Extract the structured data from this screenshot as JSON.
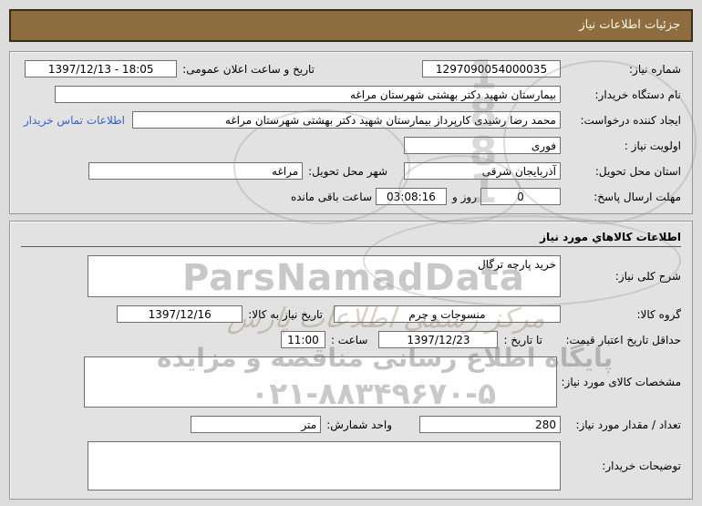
{
  "title_bar": "جزئیات اطلاعات نیاز",
  "section_need": {
    "need_number_label": "شماره نیاز:",
    "need_number_value": "1297090054000035",
    "announce_label": "تاریخ و ساعت اعلان عمومی:",
    "announce_value": "1397/12/13 - 18:05",
    "buyer_org_label": "نام دستگاه خریدار:",
    "buyer_org_value": "بیمارستان شهید دکتر بهشتی شهرستان مراغه",
    "creator_label": "ایجاد کننده درخواست:",
    "creator_value": "محمد رضا رشیدی کارپرداز بیمارستان شهید دکتر بهشتی شهرستان مراغه",
    "contact_link": "اطلاعات تماس خریدار",
    "priority_label": "اولویت نیاز :",
    "priority_value": "فوری",
    "province_label": "استان محل تحویل:",
    "province_value": "آذربایجان شرقی",
    "city_label": "شهر محل تحویل:",
    "city_value": "مراغه",
    "deadline_label": "مهلت ارسال پاسخ:",
    "deadline_days_value": "0",
    "deadline_days_suffix": "روز و",
    "deadline_time_value": "03:08:16",
    "deadline_time_suffix": "ساعت باقی مانده"
  },
  "section_goods": {
    "title": "اطلاعات کالاهاي مورد نیاز",
    "general_desc_label": "شرح کلی نیاز:",
    "general_desc_value": "خرید پارچه ترگال",
    "group_label": "گروه کالا:",
    "group_value": "منسوجات و چرم",
    "need_date_label": "تاریخ نیاز به کالا:",
    "need_date_value": "1397/12/16",
    "price_validity_label": "حداقل تاریخ اعتبار قیمت:",
    "until_date_label": "تا تاریخ :",
    "until_date_value": "1397/12/23",
    "hour_label": "ساعت :",
    "hour_value": "11:00",
    "specs_label": "مشخصات کالای مورد نیاز:",
    "specs_value": "",
    "quantity_label": "تعداد / مقدار مورد نیاز:",
    "quantity_value": "280",
    "unit_label": "واحد شمارش:",
    "unit_value": "متر",
    "buyer_notes_label": "توضیحات خریدار:",
    "buyer_notes_value": ""
  },
  "watermark": {
    "brand": "ParsNamadData",
    "digits": "1881",
    "script_line": "مرکز رسمی اطلاعات پارس",
    "line1": "پایگاه اطلاع رسانی مناقصه و مزایده",
    "phone": "۰۲۱-۸۸۳۴۹۶۷۰-۵"
  },
  "colors": {
    "header_bg": "#8E6D40",
    "page_bg": "#DCDCDC",
    "section_bg": "#E2E2E2",
    "link_color": "#3A5FCD"
  }
}
